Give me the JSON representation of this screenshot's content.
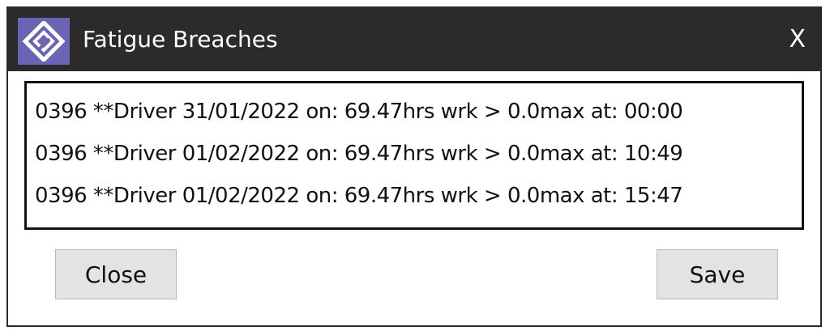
{
  "window": {
    "title": "Fatigue Breaches",
    "close_glyph": "X",
    "icon": "app-logo-icon",
    "titlebar_color": "#2b2b2b",
    "icon_color": "#6b63b3"
  },
  "breaches": [
    "0396 **Driver 31/01/2022  on: 69.47hrs wrk > 0.0max at: 00:00",
    "0396 **Driver 01/02/2022  on: 69.47hrs wrk > 0.0max at: 10:49",
    "0396 **Driver 01/02/2022  on: 69.47hrs wrk > 0.0max at: 15:47"
  ],
  "buttons": {
    "close_label": "Close",
    "save_label": "Save"
  }
}
